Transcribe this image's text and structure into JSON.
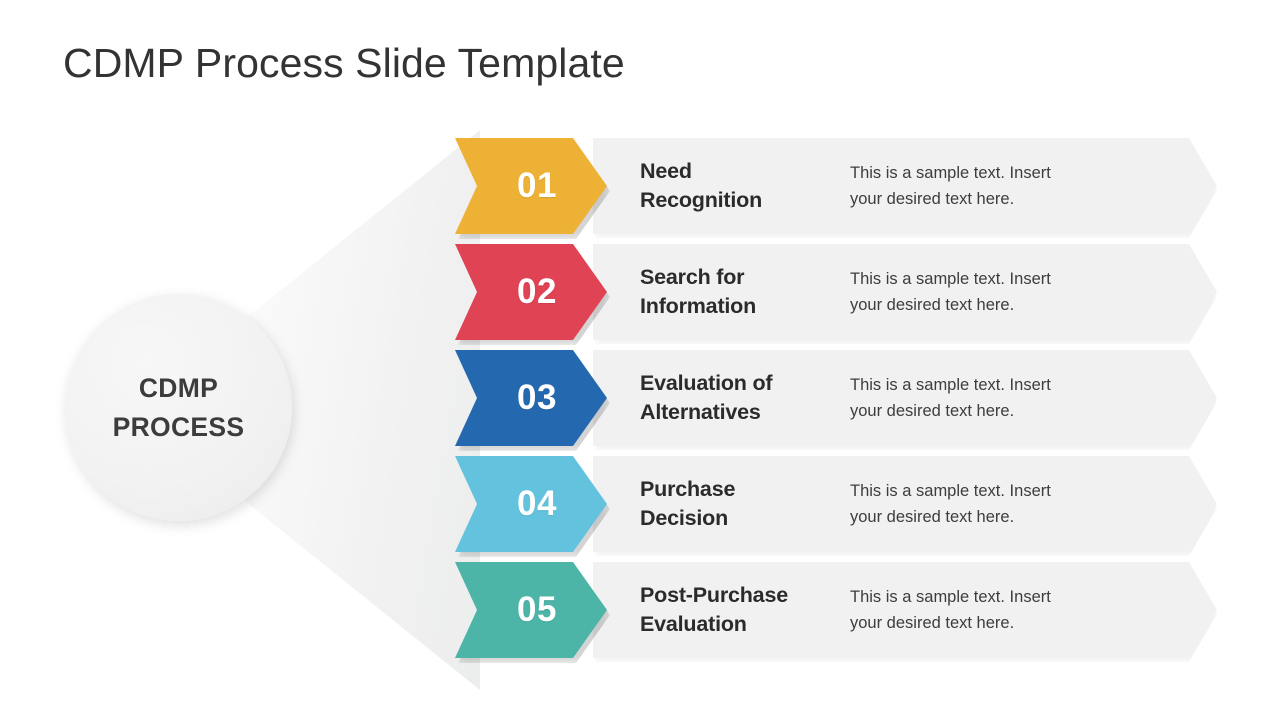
{
  "slide": {
    "title": "CDMP Process Slide Template",
    "background_color": "#ffffff"
  },
  "hub": {
    "line1": "CDMP",
    "line2": "PROCESS",
    "fill_color": "#f2f2f2",
    "text_color": "#3c3c3c"
  },
  "steps": [
    {
      "number": "01",
      "title_line1": "Need",
      "title_line2": "Recognition",
      "body_line1": "This is a sample text. Insert",
      "body_line2": "your desired text here.",
      "color": "#EDB135"
    },
    {
      "number": "02",
      "title_line1": "Search for",
      "title_line2": "Information",
      "body_line1": "This is a sample text. Insert",
      "body_line2": "your desired text here.",
      "color": "#E04353"
    },
    {
      "number": "03",
      "title_line1": "Evaluation of",
      "title_line2": "Alternatives",
      "body_line1": "This is a sample text. Insert",
      "body_line2": "your desired text here.",
      "color": "#2469AF"
    },
    {
      "number": "04",
      "title_line1": "Purchase",
      "title_line2": "Decision",
      "body_line1": "This is a sample text. Insert",
      "body_line2": "your desired text here.",
      "color": "#63C3DF"
    },
    {
      "number": "05",
      "title_line1": "Post-Purchase",
      "title_line2": "Evaluation",
      "body_line1": "This is a sample text. Insert",
      "body_line2": "your desired text here.",
      "color": "#4CB5A8"
    }
  ],
  "layout": {
    "row_bar_color": "#f1f1f1",
    "row_tops": [
      138,
      244,
      350,
      456,
      562
    ]
  }
}
